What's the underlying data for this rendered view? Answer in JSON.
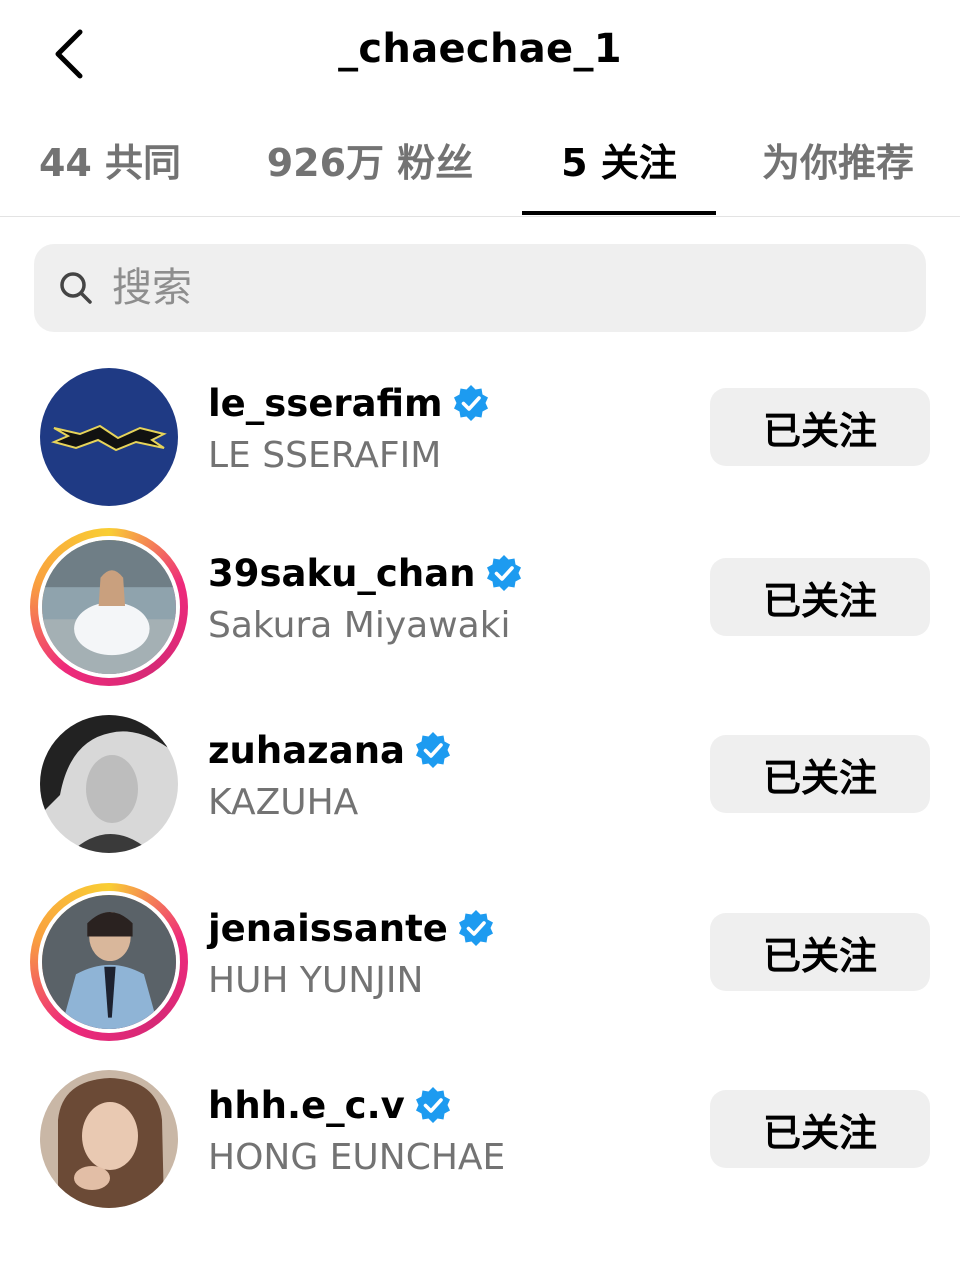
{
  "header": {
    "title": "_chaechae_1"
  },
  "tabs": [
    {
      "label": "44 共同"
    },
    {
      "label": "926万 粉丝"
    },
    {
      "label": "5 关注"
    },
    {
      "label": "为你推荐"
    }
  ],
  "search": {
    "placeholder": "搜索"
  },
  "accent": {
    "verified": "#1d9bf0",
    "ring_start": "#f9ce34",
    "ring_end": "#ee2a7b"
  },
  "users": [
    {
      "username": "le_sserafim",
      "fullname": "LE SSERAFIM",
      "button": "已关注"
    },
    {
      "username": "39saku_chan",
      "fullname": "Sakura Miyawaki",
      "button": "已关注"
    },
    {
      "username": "zuhazana",
      "fullname": "KAZUHA",
      "button": "已关注"
    },
    {
      "username": "jenaissante",
      "fullname": "HUH YUNJIN",
      "button": "已关注"
    },
    {
      "username": "hhh.e_c.v",
      "fullname": "HONG EUNCHAE",
      "button": "已关注"
    }
  ]
}
